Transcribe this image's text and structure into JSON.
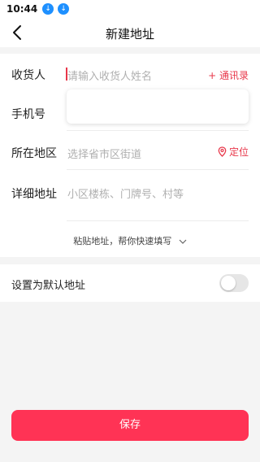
{
  "status_bar": {
    "time": "10:44",
    "notification_icons": [
      "download-icon",
      "download-icon"
    ]
  },
  "nav": {
    "title": "新建地址",
    "back_icon": "back-arrow-icon"
  },
  "form": {
    "receiver": {
      "label": "收货人",
      "placeholder": "请输入收货人姓名",
      "contacts_link": "+ 通讯录"
    },
    "phone": {
      "label": "手机号",
      "value": ""
    },
    "region": {
      "label": "所在地区",
      "placeholder": "选择省市区街道",
      "locate_link": "定位",
      "locate_icon": "location-pin-icon"
    },
    "detail": {
      "label": "详细地址",
      "placeholder": "小区楼栋、门牌号、村等"
    },
    "paste_hint": "粘贴地址，帮你快速填写"
  },
  "default_address": {
    "label": "设置为默认地址",
    "enabled": false
  },
  "save_button": {
    "label": "保存"
  },
  "colors": {
    "accent": "#e8374a",
    "primary_button": "#ff3355",
    "download_badge": "#1e90ff"
  }
}
